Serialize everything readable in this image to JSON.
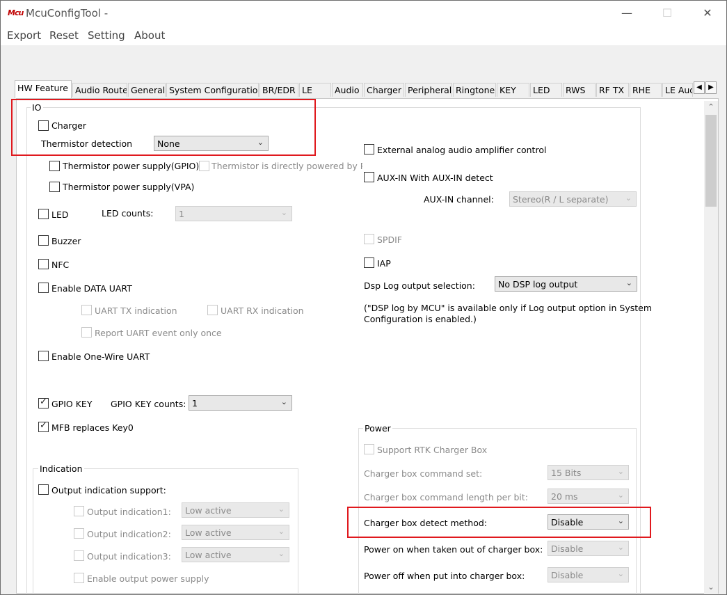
{
  "window": {
    "title": "McuConfigTool -",
    "icon_text": "Mcu",
    "minimize_glyph": "—",
    "maximize_glyph": "☐",
    "close_glyph": "✕"
  },
  "menu": {
    "export": "Export",
    "reset": "Reset",
    "setting": "Setting",
    "about": "About"
  },
  "tabs": [
    "HW Feature",
    "Audio Route",
    "General",
    "System Configuration",
    "BR/EDR",
    "LE",
    "Audio",
    "Charger",
    "Peripheral",
    "Ringtone",
    "KEY",
    "LED",
    "RWS",
    "RF TX",
    "RHE",
    "LE Aud"
  ],
  "tab_scroll": {
    "left": "◀",
    "right": "▶"
  },
  "scrollbar": {
    "up": "⌃",
    "down": "⌄"
  },
  "io": {
    "group_title": "IO",
    "charger": "Charger",
    "thermistor_detection": "Thermistor detection",
    "thermistor_detection_value": "None",
    "thermistor_gpio": "Thermistor power supply(GPIO)",
    "thermistor_pad": "Thermistor is directly powered by PAD",
    "thermistor_vpa": "Thermistor power supply(VPA)",
    "led": "LED",
    "led_counts_label": "LED counts:",
    "led_counts_value": "1",
    "buzzer": "Buzzer",
    "nfc": "NFC",
    "data_uart": "Enable DATA UART",
    "uart_tx": "UART TX indication",
    "uart_rx": "UART RX indication",
    "report_uart": "Report UART event only once",
    "one_wire_uart": "Enable One-Wire UART",
    "gpio_key": "GPIO KEY",
    "gpio_key_counts_label": "GPIO KEY counts:",
    "gpio_key_counts_value": "1",
    "mfb": "MFB replaces Key0",
    "ext_amp": "External analog audio amplifier control",
    "aux_in": "AUX-IN With AUX-IN detect",
    "aux_channel_label": "AUX-IN channel:",
    "aux_channel_value": "Stereo(R / L separate)",
    "spdif": "SPDIF",
    "iap": "IAP",
    "dsp_log_label": "Dsp Log output selection:",
    "dsp_log_value": "No DSP log output",
    "dsp_note_1": "(\"DSP log by MCU\" is available only if Log output option in System",
    "dsp_note_2": "Configuration is enabled.)"
  },
  "indication": {
    "group_title": "Indication",
    "support": "Output indication support:",
    "out1": "Output indication1:",
    "out2": "Output indication2:",
    "out3": "Output indication3:",
    "out_value": "Low active",
    "power_supply": "Enable output power supply"
  },
  "power": {
    "group_title": "Power",
    "rtk_box": "Support RTK Charger Box",
    "cmd_set_label": "Charger box command set:",
    "cmd_set_value": "15 Bits",
    "cmd_len_label": "Charger box command length per bit:",
    "cmd_len_value": "20 ms",
    "detect_label": "Charger box detect method:",
    "detect_value": "Disable",
    "power_on_label": "Power on when taken out of charger box:",
    "power_on_value": "Disable",
    "power_off_label": "Power off when put into charger box:",
    "power_off_value": "Disable"
  },
  "colors": {
    "highlight": "#e0191e",
    "icon_red": "#c00000"
  }
}
